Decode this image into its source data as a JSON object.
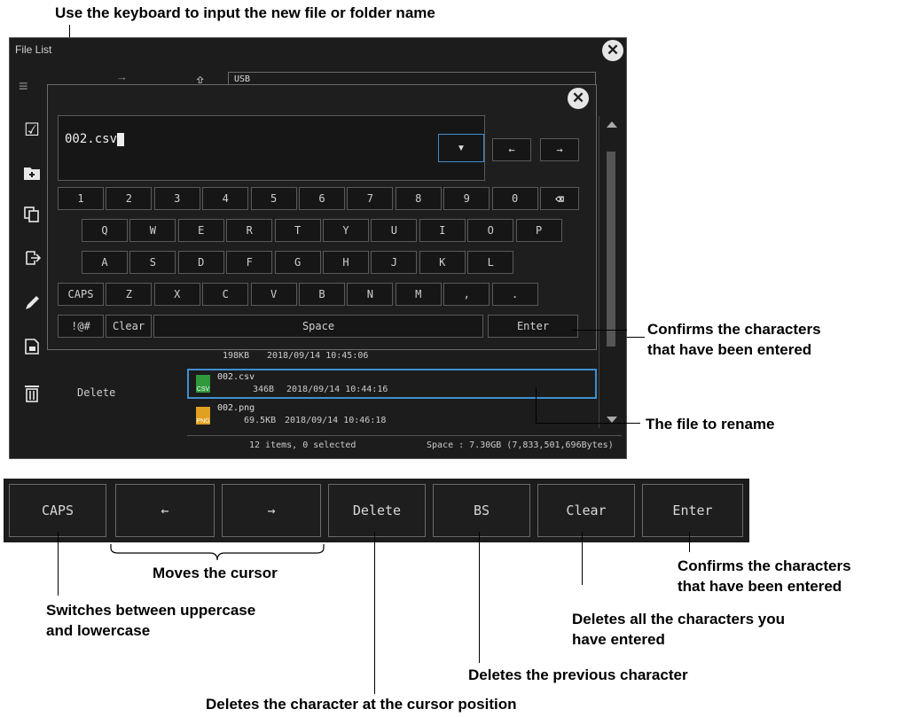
{
  "callouts": {
    "top": "Use the keyboard to input the new file or folder name",
    "confirms_top_1": "Confirms the characters",
    "confirms_top_2": "that have been entered",
    "file_to_rename": "The file to rename",
    "moves": "Moves the cursor",
    "switches_1": "Switches between uppercase",
    "switches_2": "and lowercase",
    "confirms_bottom_1": "Confirms the characters",
    "confirms_bottom_2": "that have been entered",
    "deletes_all_1": "Deletes all the characters you",
    "deletes_all_2": "have entered",
    "deletes_prev": "Deletes the previous character",
    "deletes_at_cursor": "Deletes the character at the cursor position"
  },
  "window": {
    "title": "File List",
    "path": "USB"
  },
  "keyboard": {
    "input_value": "002.csv",
    "row1": [
      "1",
      "2",
      "3",
      "4",
      "5",
      "6",
      "7",
      "8",
      "9",
      "0"
    ],
    "row2": [
      "Q",
      "W",
      "E",
      "R",
      "T",
      "Y",
      "U",
      "I",
      "O",
      "P"
    ],
    "row3": [
      "A",
      "S",
      "D",
      "F",
      "G",
      "H",
      "J",
      "K",
      "L"
    ],
    "row4": [
      "CAPS",
      "Z",
      "X",
      "C",
      "V",
      "B",
      "N",
      "M",
      ",",
      "."
    ],
    "symbols": "!@#",
    "clear": "Clear",
    "space": "Space",
    "enter": "Enter"
  },
  "files": [
    {
      "name": "",
      "size": "198KB",
      "date": "2018/09/14 10:45:06",
      "icon": "SET"
    },
    {
      "name": "002.csv",
      "size": "346B",
      "date": "2018/09/14 10:44:16",
      "icon": "CSV"
    },
    {
      "name": "002.png",
      "size": "69.5KB",
      "date": "2018/09/14 10:46:18",
      "icon": "PNG"
    }
  ],
  "sidebar": {
    "delete_label": "Delete"
  },
  "status": {
    "items": "12 items, 0 selected",
    "space": "Space : 7.30GB (7,833,501,696Bytes)"
  },
  "softkeys": [
    "CAPS",
    "←",
    "→",
    "Delete",
    "BS",
    "Clear",
    "Enter"
  ],
  "colors": {
    "screen_bg": "#1c1c1c",
    "selection_border": "#3f8fd0",
    "csv_icon": "#2e9a3c",
    "png_icon": "#e0a020"
  }
}
